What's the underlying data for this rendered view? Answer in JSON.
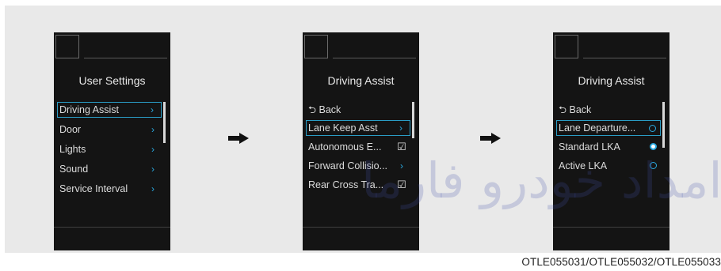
{
  "screen1": {
    "title": "User Settings",
    "items": [
      {
        "label": "Driving Assist",
        "icon": "chevron-right-icon",
        "glyph": "›",
        "selected": true
      },
      {
        "label": "Door",
        "icon": "chevron-right-icon",
        "glyph": "›"
      },
      {
        "label": "Lights",
        "icon": "chevron-right-icon",
        "glyph": "›"
      },
      {
        "label": "Sound",
        "icon": "chevron-right-icon",
        "glyph": "›"
      },
      {
        "label": "Service Interval",
        "icon": "chevron-right-icon",
        "glyph": "›"
      }
    ]
  },
  "screen2": {
    "title": "Driving Assist",
    "back_label": "Back",
    "back_glyph": "⮌",
    "items": [
      {
        "label": "Lane Keep Asst",
        "icon": "chevron-right-icon",
        "glyph": "›",
        "selected": true
      },
      {
        "label": "Autonomous E...",
        "icon": "checkbox-checked-icon",
        "glyph": "☑"
      },
      {
        "label": "Forward Collisio...",
        "icon": "chevron-right-icon",
        "glyph": "›"
      },
      {
        "label": "Rear Cross Tra...",
        "icon": "checkbox-checked-icon",
        "glyph": "☑"
      }
    ]
  },
  "screen3": {
    "title": "Driving Assist",
    "back_label": "Back",
    "back_glyph": "⮌",
    "items": [
      {
        "label": "Lane Departure...",
        "icon": "radio-off-icon",
        "checked": false,
        "selected": true
      },
      {
        "label": "Standard LKA",
        "icon": "radio-on-icon",
        "checked": true
      },
      {
        "label": "Active LKA",
        "icon": "radio-off-icon",
        "checked": false
      }
    ]
  },
  "arrows": [
    "arrow-right-icon",
    "arrow-right-icon"
  ],
  "caption": "OTLE055031/OTLE055032/OTLE055033",
  "watermark": "امداد خودرو فارما",
  "colors": {
    "accent": "#29a9e0",
    "screen_bg": "#141414",
    "stage_bg": "#e9e9e9"
  }
}
